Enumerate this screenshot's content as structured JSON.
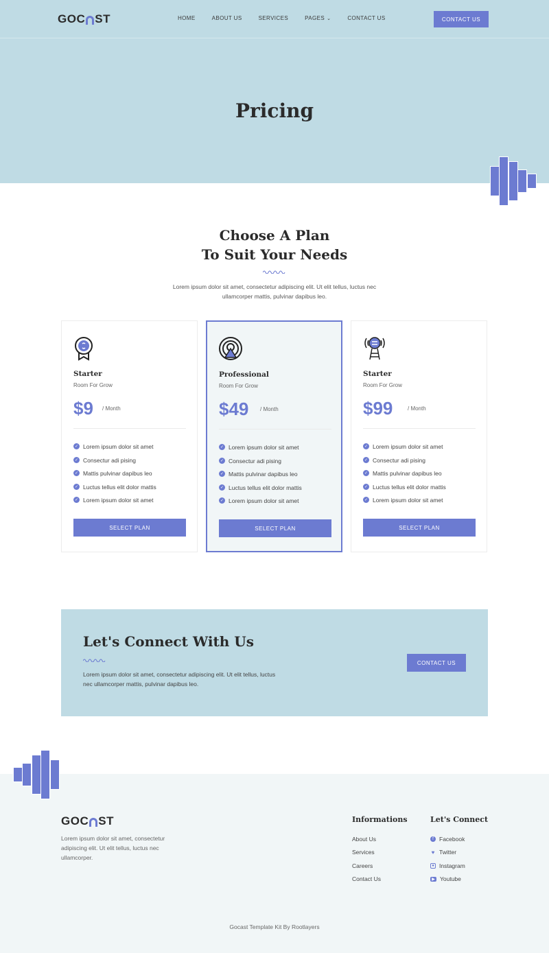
{
  "brand": {
    "logo_left": "GOC",
    "logo_right": "ST",
    "accent": "#6c7bd1",
    "hero_bg": "#bfdbe4",
    "footer_bg": "#f1f6f7"
  },
  "nav": {
    "items": [
      "HOME",
      "ABOUT US",
      "SERVICES",
      "PAGES",
      "CONTACT US"
    ],
    "pages_icon": "chevron-down-icon",
    "cta": "CONTACT US"
  },
  "hero": {
    "title": "Pricing"
  },
  "plans": {
    "title_line1": "Choose A Plan",
    "title_line2": "To Suit Your Needs",
    "description": "Lorem ipsum dolor sit amet, consectetur adipiscing elit. Ut elit tellus, luctus nec ullamcorper mattis, pulvinar dapibus leo.",
    "cards": [
      {
        "icon": "badge-icon",
        "name": "Starter",
        "subtitle": "Room For Grow",
        "price": "$9",
        "period": "/ Month",
        "features": [
          "Lorem ipsum dolor sit amet",
          "Consectur adi pising",
          "Mattis pulvinar dapibus leo",
          "Luctus tellus elit dolor mattis",
          "Lorem ipsum dolor sit amet"
        ],
        "button": "SELECT PLAN"
      },
      {
        "icon": "broadcast-icon",
        "name": "Professional",
        "subtitle": "Room For Grow",
        "price": "$49",
        "period": "/ Month",
        "features": [
          "Lorem ipsum dolor sit amet",
          "Consectur adi pising",
          "Mattis pulvinar dapibus leo",
          "Luctus tellus elit dolor mattis",
          "Lorem ipsum dolor sit amet"
        ],
        "button": "SELECT PLAN"
      },
      {
        "icon": "antenna-icon",
        "name": "Starter",
        "subtitle": "Room For Grow",
        "price": "$99",
        "period": "/ Month",
        "features": [
          "Lorem ipsum dolor sit amet",
          "Consectur adi pising",
          "Mattis pulvinar dapibus leo",
          "Luctus tellus elit dolor mattis",
          "Lorem ipsum dolor sit amet"
        ],
        "button": "SELECT PLAN"
      }
    ]
  },
  "connect": {
    "title": "Let's Connect With Us",
    "text": "Lorem ipsum dolor sit amet, consectetur adipiscing elit. Ut elit tellus, luctus nec ullamcorper mattis, pulvinar dapibus leo.",
    "cta": "CONTACT US"
  },
  "footer": {
    "about": "Lorem ipsum dolor sit amet, consectetur adipiscing elit. Ut elit tellus, luctus nec ullamcorper.",
    "info_title": "Informations",
    "info_links": [
      "About Us",
      "Services",
      "Careers",
      "Contact Us"
    ],
    "connect_title": "Let's Connect",
    "social_links": [
      {
        "icon": "facebook-icon",
        "label": "Facebook"
      },
      {
        "icon": "twitter-icon",
        "label": "Twitter"
      },
      {
        "icon": "instagram-icon",
        "label": "Instagram"
      },
      {
        "icon": "youtube-icon",
        "label": "Youtube"
      }
    ],
    "copyright": "Gocast Template Kit By Rootlayers"
  }
}
